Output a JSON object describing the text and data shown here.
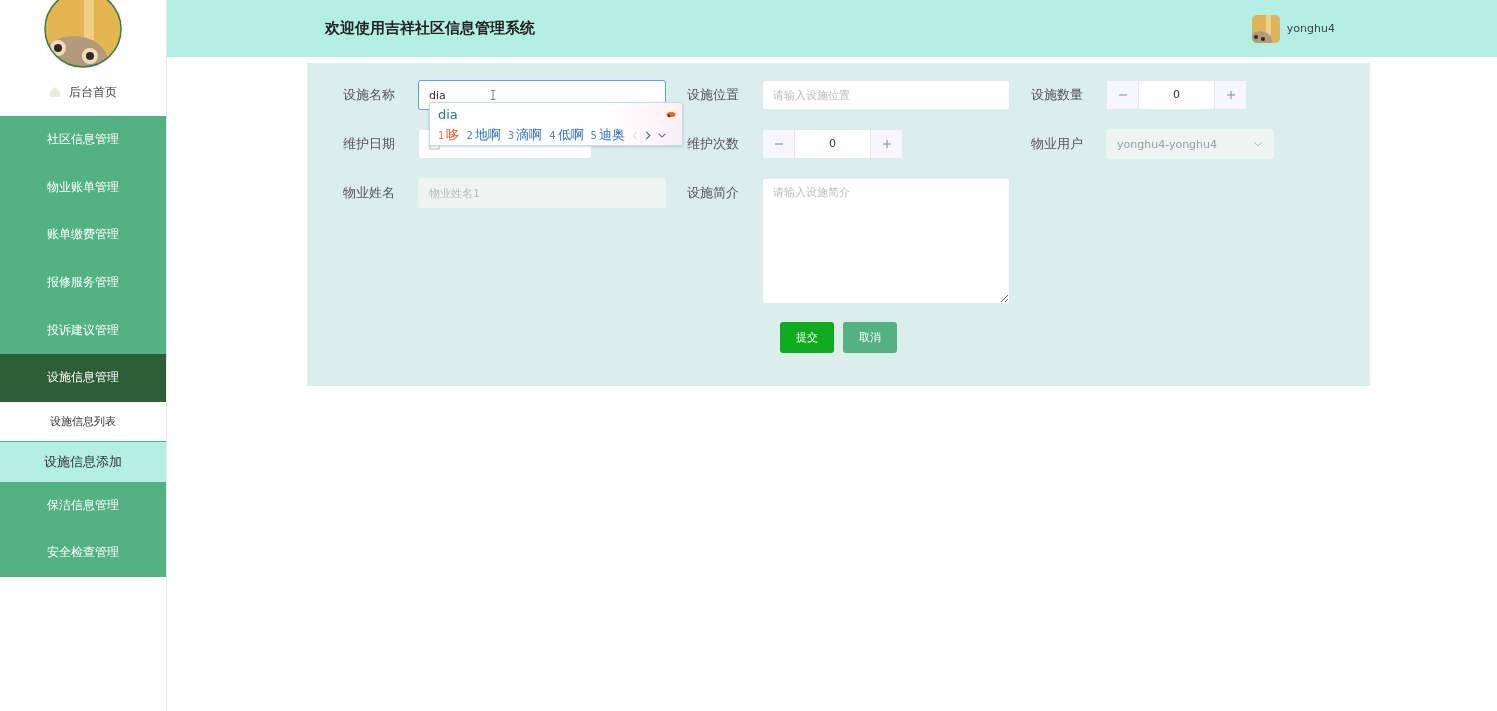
{
  "sidebar": {
    "home": "后台首页",
    "menu": [
      {
        "label": "社区信息管理",
        "selected": false
      },
      {
        "label": "物业账单管理",
        "selected": false
      },
      {
        "label": "账单缴费管理",
        "selected": false
      },
      {
        "label": "报修服务管理",
        "selected": false
      },
      {
        "label": "投诉建议管理",
        "selected": false
      },
      {
        "label": "设施信息管理",
        "selected": true,
        "children": [
          {
            "label": "设施信息列表",
            "selected": false
          },
          {
            "label": "设施信息添加",
            "selected": true
          }
        ]
      },
      {
        "label": "保洁信息管理",
        "selected": false
      },
      {
        "label": "安全检查管理",
        "selected": false
      }
    ]
  },
  "header": {
    "title": "欢迎使用吉祥社区信息管理系统",
    "username": "yonghu4"
  },
  "form": {
    "fields": [
      {
        "kind": "text",
        "label": "设施名称",
        "value": "dia",
        "focused": true,
        "disabled": false
      },
      {
        "kind": "text",
        "label": "设施位置",
        "placeholder": "请输入设施位置",
        "focused": false,
        "disabled": false
      },
      {
        "kind": "number",
        "label": "设施数量",
        "value": "0",
        "focused": false,
        "disabled": false
      },
      {
        "kind": "date",
        "label": "维护日期",
        "focused": false,
        "disabled": false
      },
      {
        "kind": "number",
        "label": "维护次数",
        "value": "0",
        "focused": false,
        "disabled": false
      },
      {
        "kind": "select",
        "label": "物业用户",
        "value": "yonghu4-yonghu4",
        "focused": false,
        "disabled": true
      },
      {
        "kind": "text",
        "label": "物业姓名",
        "placeholder": "物业姓名1",
        "focused": false,
        "disabled": true
      },
      {
        "kind": "textarea",
        "label": "设施简介",
        "placeholder": "请输入设施简介",
        "focused": false,
        "disabled": false
      }
    ],
    "buttons": [
      {
        "label": "提交",
        "kind": "primary"
      },
      {
        "label": "取消",
        "kind": "secondary"
      }
    ]
  },
  "ime": {
    "composition": "dia",
    "candidates": [
      {
        "index": "1",
        "text": "哆",
        "selected": true
      },
      {
        "index": "2",
        "text": "地啊",
        "selected": false
      },
      {
        "index": "3",
        "text": "滴啊",
        "selected": false
      },
      {
        "index": "4",
        "text": "低啊",
        "selected": false
      },
      {
        "index": "5",
        "text": "迪奥",
        "selected": false
      }
    ]
  }
}
